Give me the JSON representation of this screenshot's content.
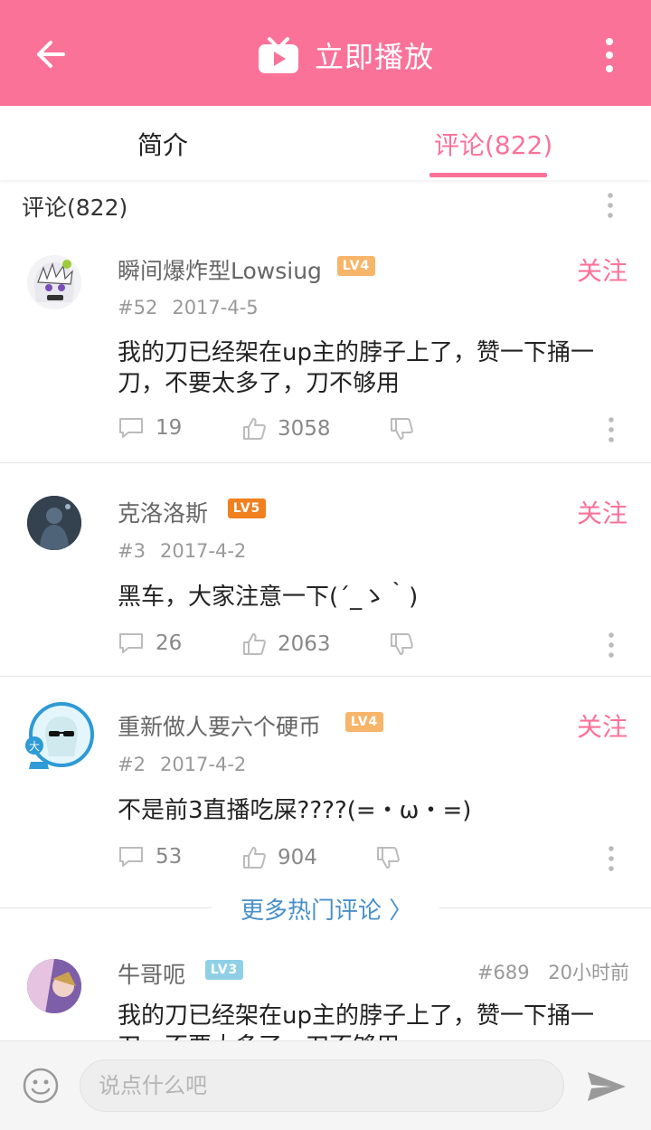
{
  "header": {
    "title": "立即播放",
    "accent": "#fb7299"
  },
  "tabs": [
    {
      "label": "简介"
    },
    {
      "label": "评论(822)"
    }
  ],
  "section": {
    "title": "评论(822)"
  },
  "hot_comments": [
    {
      "username": "瞬间爆炸型Lowsiug",
      "level": "LV4",
      "level_color": "#f7b56a",
      "follow": "关注",
      "floor": "#52",
      "date": "2017-4-5",
      "text": "我的刀已经架在up主的脖子上了，赞一下捅一刀，不要太多了，刀不够用",
      "replies": "19",
      "likes": "3058"
    },
    {
      "username": "克洛洛斯",
      "level": "LV5",
      "level_color": "#f0811e",
      "follow": "关注",
      "floor": "#3",
      "date": "2017-4-2",
      "text": "黑车，大家注意一下(´_ゝ｀)",
      "replies": "26",
      "likes": "2063"
    },
    {
      "username": "重新做人要六个硬币",
      "level": "LV4",
      "level_color": "#f7b56a",
      "follow": "关注",
      "floor": "#2",
      "date": "2017-4-2",
      "text": "不是前3直播吃屎????(=・ω・=)",
      "replies": "53",
      "likes": "904"
    }
  ],
  "more_hot": {
    "label": "更多热门评论 〉"
  },
  "latest_comment": {
    "username": "牛哥呃",
    "level": "LV3",
    "level_color": "#8fd0e6",
    "floor": "#689",
    "time": "20小时前",
    "text": "我的刀已经架在up主的脖子上了，赞一下捅一刀，不要太多了，刀不够用"
  },
  "input": {
    "placeholder": "说点什么吧"
  }
}
